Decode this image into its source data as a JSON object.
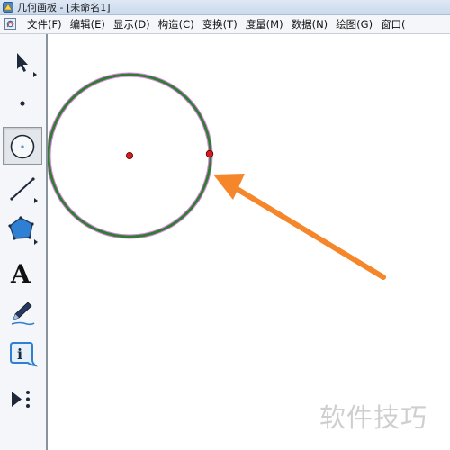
{
  "window": {
    "title": "几何画板 - [未命名1]"
  },
  "menu": {
    "items": [
      "文件(F)",
      "编辑(E)",
      "显示(D)",
      "构造(C)",
      "变换(T)",
      "度量(M)",
      "数据(N)",
      "绘图(G)",
      "窗口("
    ]
  },
  "toolbox": {
    "tools": [
      {
        "name": "arrow-select-tool",
        "selected": false
      },
      {
        "name": "point-tool",
        "selected": false
      },
      {
        "name": "compass-tool",
        "selected": true
      },
      {
        "name": "straightedge-tool",
        "selected": false
      },
      {
        "name": "polygon-tool",
        "selected": false
      },
      {
        "name": "text-tool",
        "label": "A",
        "selected": false
      },
      {
        "name": "marker-tool",
        "selected": false
      },
      {
        "name": "information-tool",
        "label": "i",
        "selected": false
      },
      {
        "name": "custom-tools",
        "selected": false
      }
    ]
  },
  "canvas": {
    "circle_color": "#2e7d32",
    "circle_selection_color": "#e07be0",
    "point_color": "#d81b1b",
    "arrow_color": "#f5862a"
  },
  "watermark": {
    "text": "软件技巧"
  }
}
